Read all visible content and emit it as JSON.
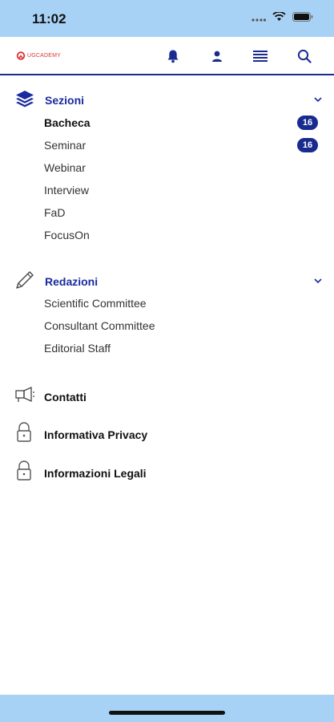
{
  "status": {
    "time": "11:02"
  },
  "header": {
    "logo_text": "UGCADEMY",
    "icons": [
      "bell-icon",
      "user-icon",
      "menu-icon",
      "search-icon"
    ]
  },
  "sections": {
    "sezioni": {
      "title": "Sezioni",
      "items": [
        {
          "label": "Bacheca",
          "badge": "16"
        },
        {
          "label": "Seminar",
          "badge": "16"
        },
        {
          "label": "Webinar"
        },
        {
          "label": "Interview"
        },
        {
          "label": "FaD"
        },
        {
          "label": "FocusOn"
        }
      ]
    },
    "redazioni": {
      "title": "Redazioni",
      "items": [
        {
          "label": "Scientific Committee"
        },
        {
          "label": "Consultant Committee"
        },
        {
          "label": "Editorial Staff"
        }
      ]
    }
  },
  "links": [
    {
      "label": "Contatti",
      "icon": "megaphone-icon"
    },
    {
      "label": "Informativa Privacy",
      "icon": "lock-icon"
    },
    {
      "label": "Informazioni Legali",
      "icon": "lock-icon"
    }
  ],
  "colors": {
    "accent": "#1a2b9f",
    "badge": "#1a2b8f",
    "status_bar": "#a8d2f5",
    "logo": "#dd3333"
  }
}
